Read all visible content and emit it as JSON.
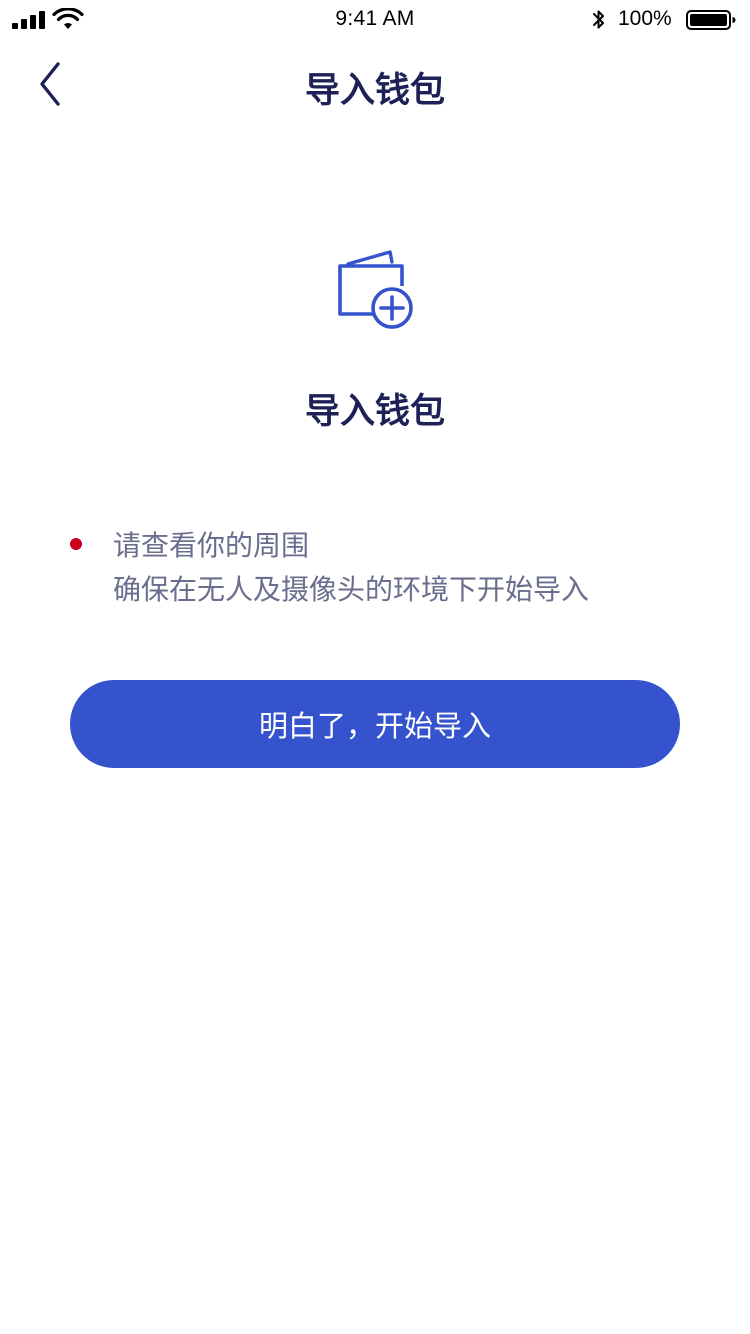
{
  "status_bar": {
    "time": "9:41 AM",
    "battery_percent": "100%",
    "signal_icon": "cellular-signal-icon",
    "wifi_icon": "wifi-icon",
    "bluetooth_icon": "bluetooth-icon",
    "battery_icon": "battery-icon"
  },
  "nav": {
    "back_icon": "chevron-left-icon",
    "title": "导入钱包"
  },
  "hero": {
    "icon": "wallet-add-icon",
    "title": "导入钱包"
  },
  "notice": {
    "line1": "请查看你的周围",
    "line2": "确保在无人及摄像头的环境下开始导入"
  },
  "primary_button": {
    "label": "明白了，开始导入"
  },
  "colors": {
    "accent": "#3453cc",
    "title_text": "#1d2156",
    "body_text": "#6a6d8e",
    "bullet": "#c8001e",
    "background": "#ffffff"
  }
}
